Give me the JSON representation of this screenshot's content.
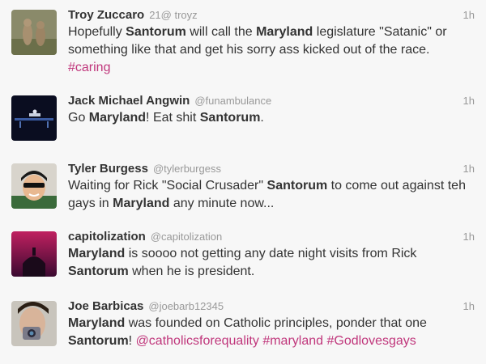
{
  "tweets": [
    {
      "name": "Troy Zuccaro",
      "handle": "21@ troyz",
      "time": "1h",
      "segments": [
        {
          "t": "Hopefully "
        },
        {
          "t": "Santorum",
          "b": true
        },
        {
          "t": " will call the "
        },
        {
          "t": "Maryland",
          "b": true
        },
        {
          "t": " legislature \"Satanic\" or something like that and get his sorry ass kicked out of the race. "
        },
        {
          "t": "#caring",
          "tag": true
        }
      ]
    },
    {
      "name": "Jack Michael Angwin",
      "handle": "@funambulance",
      "time": "1h",
      "segments": [
        {
          "t": "Go "
        },
        {
          "t": "Maryland",
          "b": true
        },
        {
          "t": "! Eat shit "
        },
        {
          "t": "Santorum",
          "b": true
        },
        {
          "t": "."
        }
      ]
    },
    {
      "name": "Tyler Burgess",
      "handle": "@tylerburgess",
      "time": "1h",
      "segments": [
        {
          "t": "Waiting for Rick \"Social Crusader\" "
        },
        {
          "t": "Santorum",
          "b": true
        },
        {
          "t": " to come out against teh gays in "
        },
        {
          "t": "Maryland",
          "b": true
        },
        {
          "t": " any minute now..."
        }
      ]
    },
    {
      "name": "capitolization",
      "handle": "@capitolization",
      "time": "1h",
      "segments": [
        {
          "t": "Maryland",
          "b": true
        },
        {
          "t": " is soooo not getting any date night visits from Rick "
        },
        {
          "t": "Santorum",
          "b": true
        },
        {
          "t": " when he is president."
        }
      ]
    },
    {
      "name": "Joe Barbicas",
      "handle": "@joebarb12345",
      "time": "1h",
      "segments": [
        {
          "t": "Maryland",
          "b": true
        },
        {
          "t": " was founded on Catholic principles, ponder that one "
        },
        {
          "t": "Santorum",
          "b": true
        },
        {
          "t": "! "
        },
        {
          "t": "@catholicsforequality",
          "tag": true
        },
        {
          "t": " "
        },
        {
          "t": "#maryland",
          "tag": true
        },
        {
          "t": " "
        },
        {
          "t": "#Godlovesgays",
          "tag": true
        }
      ]
    }
  ]
}
